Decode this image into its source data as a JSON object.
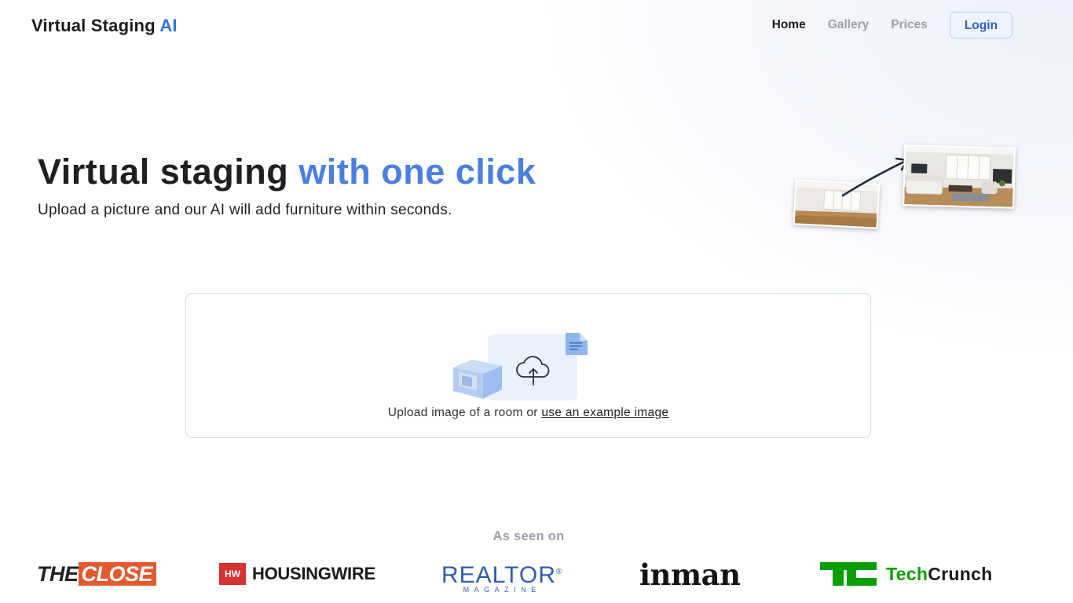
{
  "header": {
    "brand_main": "Virtual Staging ",
    "brand_accent": "AI",
    "nav": [
      {
        "label": "Home",
        "active": true
      },
      {
        "label": "Gallery",
        "active": false
      },
      {
        "label": "Prices",
        "active": false
      }
    ],
    "login_label": "Login"
  },
  "hero": {
    "title_main": "Virtual staging",
    "title_accent": "with one click",
    "subtitle": "Upload a picture and our AI will add furniture within seconds."
  },
  "upload": {
    "text": "Upload image of a room or ",
    "link": "use an example image"
  },
  "press": {
    "heading": "As seen on",
    "logos": [
      {
        "name": "THE CLOSE",
        "part1": "THE",
        "part2": "CLOSE"
      },
      {
        "name": "HOUSINGWIRE",
        "badge": "HW",
        "word": "HOUSINGWIRE"
      },
      {
        "name": "REALTOR MAGAZINE",
        "word": "REALTOR",
        "mark": "®",
        "sub": "MAGAZINE"
      },
      {
        "name": "inman",
        "word": "inman"
      },
      {
        "name": "TechCrunch",
        "part1": "Tech",
        "part2": "Crunch"
      }
    ]
  },
  "colors": {
    "accent": "#4a7fe0",
    "login_bg": "#eef4ff",
    "close_orange": "#e35a2e",
    "housingwire_red": "#d6322f",
    "realtor_blue": "#2f5ea8",
    "techcrunch_green": "#0a9e01"
  },
  "icons": [
    "curved-arrow-icon",
    "cloud-upload-icon",
    "document-icon",
    "cube-icon"
  ]
}
